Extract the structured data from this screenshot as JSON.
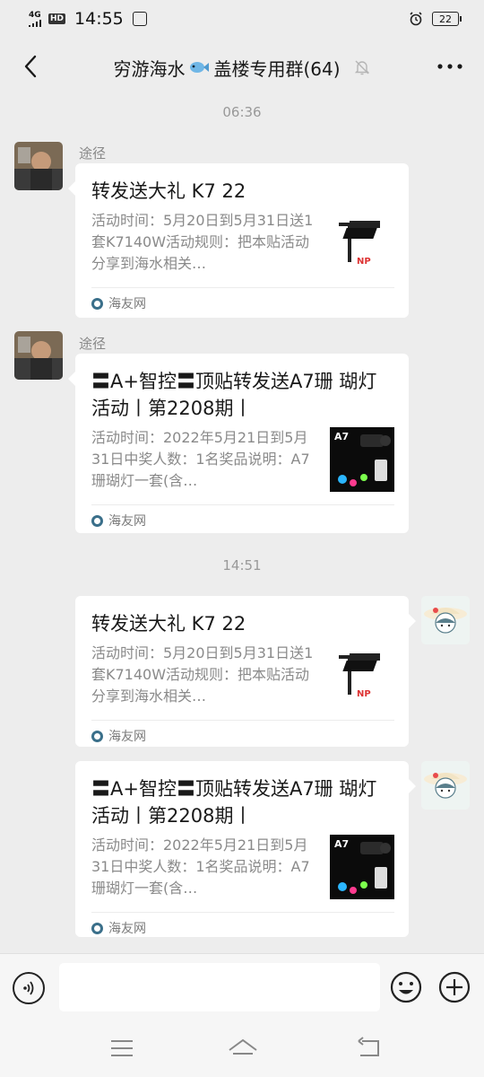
{
  "status": {
    "network": "4G",
    "hd": "HD",
    "time": "14:55",
    "battery": "22"
  },
  "header": {
    "title_before": "穷游海水",
    "title_after": "盖楼专用群(64)",
    "icons": [
      "back-arrow-icon",
      "fish-emoji-icon",
      "mute-bell-icon",
      "more-dots-icon"
    ]
  },
  "timestamps": [
    "06:36",
    "14:51"
  ],
  "messages": [
    {
      "side": "left",
      "sender": "途径",
      "title": "转发送大礼 K7 22",
      "desc": "活动时间：5月20日到5月31日送1套K7140W活动规则：把本贴活动分享到海水相关…",
      "thumb": "k7-lamp",
      "source": "海友网"
    },
    {
      "side": "left",
      "sender": "途径",
      "title": "〓A+智控〓顶贴转发送A7珊 瑚灯活动丨第2208期丨",
      "desc": "活动时间：2022年5月21日到5月31日中奖人数：1名奖品说明：A7珊瑚灯一套(含…",
      "thumb": "a7-lamp",
      "thumb_label": "A7",
      "source": "海友网"
    },
    {
      "side": "right",
      "title": "转发送大礼 K7 22",
      "desc": "活动时间：5月20日到5月31日送1套K7140W活动规则：把本贴活动分享到海水相关…",
      "thumb": "k7-lamp",
      "source": "海友网"
    },
    {
      "side": "right",
      "title": "〓A+智控〓顶贴转发送A7珊 瑚灯活动丨第2208期丨",
      "desc": "活动时间：2022年5月21日到5月31日中奖人数：1名奖品说明：A7珊瑚灯一套(含…",
      "thumb": "a7-lamp",
      "thumb_label": "A7",
      "source": "海友网"
    }
  ],
  "input": {
    "placeholder": "",
    "icons": [
      "voice-icon",
      "emoji-icon",
      "plus-icon"
    ]
  },
  "nav": {
    "icons": [
      "menu-icon",
      "home-icon",
      "back-icon"
    ]
  },
  "colors": {
    "background": "#ededed",
    "bubble": "#ffffff",
    "timestamp": "#999999",
    "source_icon": "#3a6f8a"
  }
}
